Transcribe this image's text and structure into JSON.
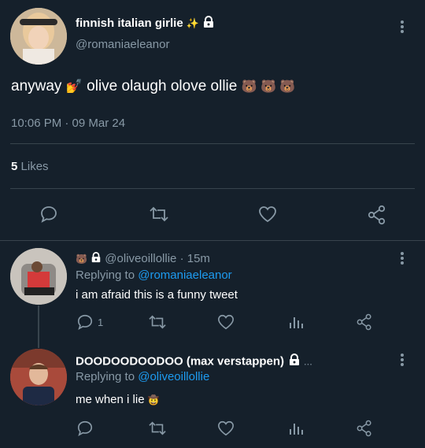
{
  "tweet": {
    "display_name": "finnish italian girlie",
    "name_emoji": "✨",
    "handle": "@romaniaeleanor",
    "text_before": "anyway",
    "text_after": "olive olaugh olove ollie",
    "text_emojis": "🐻 🐻 🐻",
    "inline_emoji": "💅",
    "timestamp": "10:06 PM · 09 Mar 24",
    "likes_count": "5",
    "likes_label": "Likes"
  },
  "replies": [
    {
      "name_emoji": "🐻",
      "handle": "@oliveoillollie",
      "time": "· 15m",
      "replying_prefix": "Replying to",
      "replying_to": "@romaniaeleanor",
      "text": "i am afraid this is a funny tweet",
      "reply_count": "1"
    },
    {
      "display_name": "DOODOODOODOO (max verstappen)",
      "ellipsis": "...",
      "replying_prefix": "Replying to",
      "replying_to": "@oliveoillollie",
      "text": "me when i lie",
      "text_emoji": "🤠"
    }
  ],
  "colors": {
    "background": "#15202b",
    "muted": "#8899a6",
    "link": "#1d9bf0",
    "divider": "#38444d"
  }
}
